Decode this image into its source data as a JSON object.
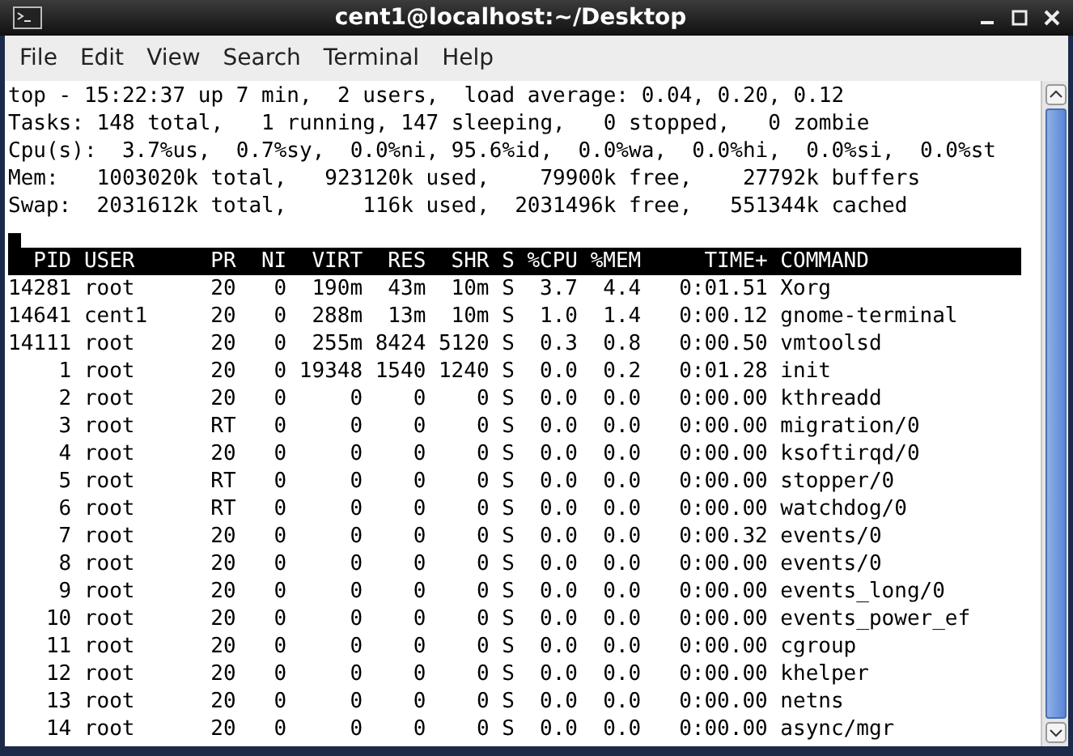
{
  "window": {
    "title": "cent1@localhost:~/Desktop"
  },
  "menu": [
    "File",
    "Edit",
    "View",
    "Search",
    "Terminal",
    "Help"
  ],
  "summary": [
    "top - 15:22:37 up 7 min,  2 users,  load average: 0.04, 0.20, 0.12",
    "Tasks: 148 total,   1 running, 147 sleeping,   0 stopped,   0 zombie",
    "Cpu(s):  3.7%us,  0.7%sy,  0.0%ni, 95.6%id,  0.0%wa,  0.0%hi,  0.0%si,  0.0%st",
    "Mem:   1003020k total,   923120k used,    79900k free,    27792k buffers",
    "Swap:  2031612k total,      116k used,  2031496k free,   551344k cached"
  ],
  "table": {
    "columns": [
      "PID",
      "USER",
      "PR",
      "NI",
      "VIRT",
      "RES",
      "SHR",
      "S",
      "%CPU",
      "%MEM",
      "TIME+",
      "COMMAND"
    ],
    "rows": [
      [
        "14281",
        "root",
        "20",
        "0",
        "190m",
        "43m",
        "10m",
        "S",
        "3.7",
        "4.4",
        "0:01.51",
        "Xorg"
      ],
      [
        "14641",
        "cent1",
        "20",
        "0",
        "288m",
        "13m",
        "10m",
        "S",
        "1.0",
        "1.4",
        "0:00.12",
        "gnome-terminal"
      ],
      [
        "14111",
        "root",
        "20",
        "0",
        "255m",
        "8424",
        "5120",
        "S",
        "0.3",
        "0.8",
        "0:00.50",
        "vmtoolsd"
      ],
      [
        "1",
        "root",
        "20",
        "0",
        "19348",
        "1540",
        "1240",
        "S",
        "0.0",
        "0.2",
        "0:01.28",
        "init"
      ],
      [
        "2",
        "root",
        "20",
        "0",
        "0",
        "0",
        "0",
        "S",
        "0.0",
        "0.0",
        "0:00.00",
        "kthreadd"
      ],
      [
        "3",
        "root",
        "RT",
        "0",
        "0",
        "0",
        "0",
        "S",
        "0.0",
        "0.0",
        "0:00.00",
        "migration/0"
      ],
      [
        "4",
        "root",
        "20",
        "0",
        "0",
        "0",
        "0",
        "S",
        "0.0",
        "0.0",
        "0:00.00",
        "ksoftirqd/0"
      ],
      [
        "5",
        "root",
        "RT",
        "0",
        "0",
        "0",
        "0",
        "S",
        "0.0",
        "0.0",
        "0:00.00",
        "stopper/0"
      ],
      [
        "6",
        "root",
        "RT",
        "0",
        "0",
        "0",
        "0",
        "S",
        "0.0",
        "0.0",
        "0:00.00",
        "watchdog/0"
      ],
      [
        "7",
        "root",
        "20",
        "0",
        "0",
        "0",
        "0",
        "S",
        "0.0",
        "0.0",
        "0:00.32",
        "events/0"
      ],
      [
        "8",
        "root",
        "20",
        "0",
        "0",
        "0",
        "0",
        "S",
        "0.0",
        "0.0",
        "0:00.00",
        "events/0"
      ],
      [
        "9",
        "root",
        "20",
        "0",
        "0",
        "0",
        "0",
        "S",
        "0.0",
        "0.0",
        "0:00.00",
        "events_long/0"
      ],
      [
        "10",
        "root",
        "20",
        "0",
        "0",
        "0",
        "0",
        "S",
        "0.0",
        "0.0",
        "0:00.00",
        "events_power_ef"
      ],
      [
        "11",
        "root",
        "20",
        "0",
        "0",
        "0",
        "0",
        "S",
        "0.0",
        "0.0",
        "0:00.00",
        "cgroup"
      ],
      [
        "12",
        "root",
        "20",
        "0",
        "0",
        "0",
        "0",
        "S",
        "0.0",
        "0.0",
        "0:00.00",
        "khelper"
      ],
      [
        "13",
        "root",
        "20",
        "0",
        "0",
        "0",
        "0",
        "S",
        "0.0",
        "0.0",
        "0:00.00",
        "netns"
      ],
      [
        "14",
        "root",
        "20",
        "0",
        "0",
        "0",
        "0",
        "S",
        "0.0",
        "0.0",
        "0:00.00",
        "async/mgr"
      ]
    ]
  }
}
